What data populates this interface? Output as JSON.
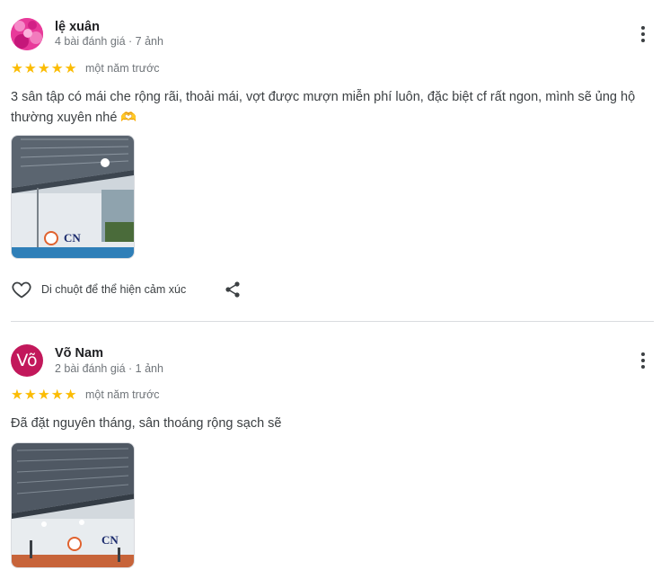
{
  "reviews": [
    {
      "author": "lệ xuân",
      "stats": "4 bài đánh giá · 7 ảnh",
      "rating": 5,
      "time": "một năm trước",
      "text": "3 sân tập có mái che rộng rãi, thoải mái, vợt được mượn miễn phí luôn, đặc biệt cf rất ngon, mình sẽ ủng hộ thường xuyên nhé 🫶",
      "reaction_label": "Di chuột để thể hiện cảm xúc",
      "photo_logo": "CN"
    },
    {
      "author": "Võ Nam",
      "avatar_letter": "Võ",
      "avatar_color": "#c2185b",
      "stats": "2 bài đánh giá · 1 ảnh",
      "rating": 5,
      "time": "một năm trước",
      "text": "Đã đặt nguyên tháng, sân thoáng rộng sạch sẽ",
      "photo_logo": "CN"
    }
  ],
  "colors": {
    "star": "#fbbc04",
    "divider": "#dadce0",
    "secondary_text": "#70757a"
  }
}
